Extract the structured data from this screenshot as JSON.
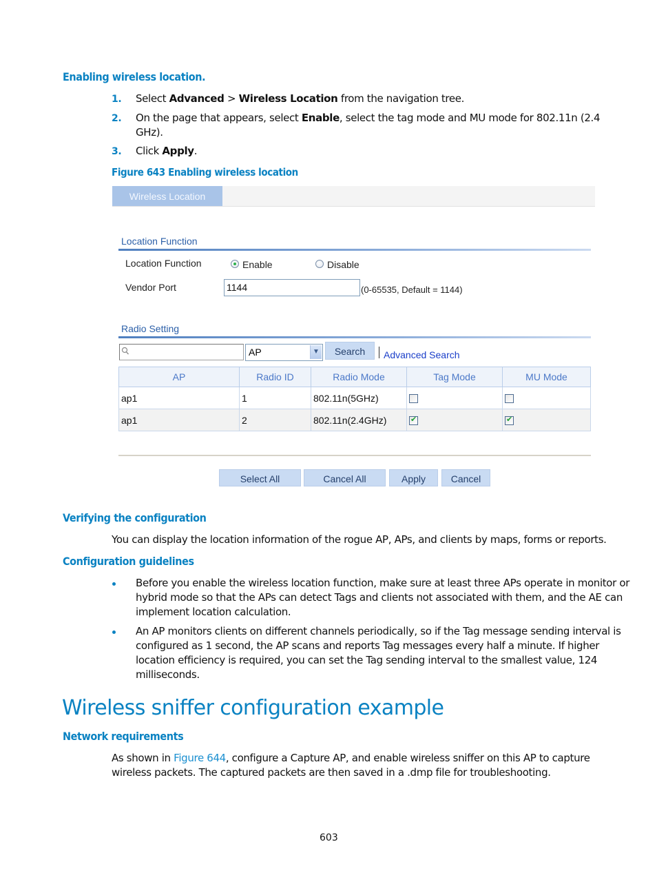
{
  "section_enabling": {
    "heading": "Enabling wireless location.",
    "steps": [
      {
        "num": "1.",
        "pre": "Select ",
        "b1": "Advanced",
        "mid": " > ",
        "b2": "Wireless Location",
        "post": " from the navigation tree."
      },
      {
        "num": "2.",
        "pre": "On the page that appears, select ",
        "b1": "Enable",
        "post_line1": ", select the tag mode and MU mode for 802.11n (2.4",
        "post_line2": "GHz)."
      },
      {
        "num": "3.",
        "pre": "Click ",
        "b1": "Apply",
        "post": "."
      }
    ],
    "figure_caption": "Figure 643 Enabling wireless location"
  },
  "figure": {
    "tab_label": "Wireless Location",
    "location_function": {
      "section_title": "Location Function",
      "field_label": "Location Function",
      "options": [
        {
          "label": "Enable",
          "selected": true
        },
        {
          "label": "Disable",
          "selected": false
        }
      ],
      "vendor_port_label": "Vendor Port",
      "vendor_port_value": "1144",
      "vendor_port_hint": "(0-65535, Default = 1144)"
    },
    "radio_setting": {
      "section_title": "Radio Setting",
      "search_value": "",
      "search_field_select": "AP",
      "search_button": "Search",
      "advanced_search": "Advanced Search",
      "columns": [
        "AP",
        "Radio ID",
        "Radio Mode",
        "Tag Mode",
        "MU Mode"
      ],
      "rows": [
        {
          "ap": "ap1",
          "radio_id": "1",
          "radio_mode": "802.11n(5GHz)",
          "tag_mode": false,
          "mu_mode": false
        },
        {
          "ap": "ap1",
          "radio_id": "2",
          "radio_mode": "802.11n(2.4GHz)",
          "tag_mode": true,
          "mu_mode": true
        }
      ]
    },
    "buttons": {
      "select_all": "Select All",
      "cancel_all": "Cancel All",
      "apply": "Apply",
      "cancel": "Cancel"
    }
  },
  "section_verifying": {
    "heading": "Verifying the configuration",
    "text": "You can display the location information of the rogue AP, APs, and clients by maps, forms or reports."
  },
  "section_guidelines": {
    "heading": "Configuration guidelines",
    "bullets": [
      {
        "lines": [
          "Before you enable the wireless location function, make sure at least three APs operate in monitor or",
          "hybrid mode so that the APs can detect Tags and clients not associated with them, and the AE can",
          "implement location calculation."
        ]
      },
      {
        "lines": [
          "An AP monitors clients on different channels periodically, so if the Tag message sending interval is",
          "configured as 1 second, the AP scans and reports Tag messages every half a minute. If higher",
          "location efficiency is required, you can set the Tag sending interval to the smallest value, 124",
          "milliseconds."
        ]
      }
    ]
  },
  "section_sniffer": {
    "title": "Wireless sniffer configuration example",
    "subheading": "Network requirements",
    "para_pre": "As shown in ",
    "para_link": "Figure 644",
    "para_post_line1": ", configure a Capture AP, and enable wireless sniffer on this AP to capture",
    "para_line2": "wireless packets. The captured packets are then saved in a .dmp file for troubleshooting."
  },
  "page_number": "603",
  "colors": {
    "heading_blue": "#0a82c2",
    "tab_active": "#a9c4e8",
    "button_bg": "#c9dbf3",
    "check_green": "#21a034"
  }
}
